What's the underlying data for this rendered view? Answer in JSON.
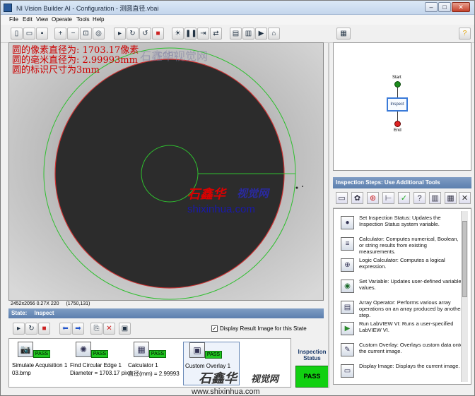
{
  "window": {
    "title": "NI Vision Builder AI - Configuration - 测圆直径.vbai",
    "min": "–",
    "max": "□",
    "close": "✕"
  },
  "menu": [
    "File",
    "Edit",
    "View",
    "Operate",
    "Tools",
    "Help"
  ],
  "image": {
    "overlay_lines": [
      "圆的像素直径为: 1703.17像素",
      "圆的毫米直径为: 2.99993mm",
      "圆的标识尺寸为3mm"
    ],
    "status_dims": "2452x2056 0.27X 220",
    "status_coord": "(1750,131)"
  },
  "watermark": {
    "cn_name": "石鑫华",
    "cn_sub": "视觉网",
    "url": "shixinhua.com",
    "url_full": "www.shixinhua.com",
    "top_cn": "石鑫华视觉网",
    "top_url": "com"
  },
  "state": {
    "label": "State:",
    "value": "Inspect"
  },
  "display_checkbox": {
    "checked": "✓",
    "label": "Display Result Image for this State"
  },
  "steps": [
    {
      "name": "Simulate Acquisition 1",
      "result": "03.bmp",
      "status": "PASS",
      "icon": "📷"
    },
    {
      "name": "Find Circular Edge 1",
      "result": "Diameter = 1703.17 pix",
      "status": "PASS",
      "icon": "✺"
    },
    {
      "name": "Calculator 1",
      "result": "直径(mm) = 2.99993",
      "status": "PASS",
      "icon": "▦"
    },
    {
      "name": "Custom Overlay 1",
      "result": "",
      "status": "PASS",
      "icon": "▣"
    }
  ],
  "inspection_status": {
    "label1": "Inspection",
    "label2": "Status",
    "value": "PASS"
  },
  "state_diagram": {
    "start": "Start",
    "inspect": "Inspect",
    "end": "End"
  },
  "tools_panel": {
    "header": "Inspection Steps: Use Additional Tools"
  },
  "tools": [
    {
      "icon": "●",
      "text": "Set Inspection Status: Updates the Inspection Status system variable."
    },
    {
      "icon": "≡",
      "text": "Calculator: Computes numerical, Boolean, or string results from existing measurements."
    },
    {
      "icon": "⊕",
      "text": "Logic Calculator: Computes a logical expression."
    },
    {
      "icon": "◉",
      "text": "Set Variable: Updates user-defined variable values."
    },
    {
      "icon": "▤",
      "text": "Array Operator: Performs various array operations on an array produced by another step."
    },
    {
      "icon": "▶",
      "text": "Run LabVIEW VI: Runs a user-specified LabVIEW VI."
    },
    {
      "icon": "✎",
      "text": "Custom Overlay: Overlays custom data onto the current image."
    },
    {
      "icon": "▭",
      "text": "Display Image: Displays the current image."
    }
  ],
  "colors": {
    "accent": "#5c7fae",
    "pass": "#1fc61f",
    "overlay_text": "#c00000",
    "circle_green": "#2fbf2f",
    "circle_red": "#cc3333"
  }
}
